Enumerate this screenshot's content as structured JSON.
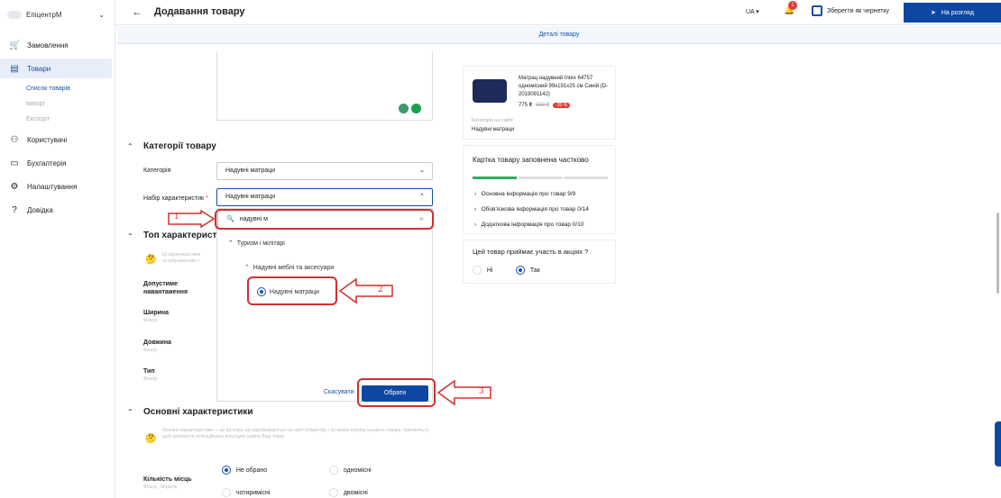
{
  "sidebar": {
    "brand": "ЕпіцентрМ",
    "items": [
      {
        "label": "Замовлення",
        "icon": "cart-icon"
      },
      {
        "label": "Товари",
        "icon": "box-icon"
      },
      {
        "label": "Користувачі",
        "icon": "users-icon"
      },
      {
        "label": "Бухгалтерія",
        "icon": "wallet-icon"
      },
      {
        "label": "Налаштування",
        "icon": "gear-icon"
      },
      {
        "label": "Довідка",
        "icon": "help-icon"
      }
    ],
    "subitems": [
      "Список товарів",
      "Імпорт",
      "Експорт"
    ]
  },
  "header": {
    "title": "Додавання товару",
    "lang": "UA",
    "notif_count": "1",
    "save_draft": "Зберегти як чернетку",
    "review": "На розгляд"
  },
  "tabs": {
    "details": "Деталі товару"
  },
  "sections": {
    "categories_title": "Категорії товару",
    "top_title": "Топ характеристи",
    "basic_title": "Основні характеристики"
  },
  "fields": {
    "category_label": "Категорія",
    "category_value": "Надувні матраци",
    "set_label": "Набір характеристик",
    "set_required": "*",
    "set_value": "Надувні матраци"
  },
  "dropdown": {
    "search_value": "надувні м",
    "level1": "Туризм і мілітарі",
    "level2": "Надувні меблі та аксесуари",
    "option": "Надувні матраци",
    "cancel": "Скасувати",
    "select": "Обрати"
  },
  "annotations": [
    "1",
    "2",
    "3"
  ],
  "top_chars": {
    "info": "Ці характеристики\nта зображенням т",
    "rows": [
      {
        "label": "Допустиме навантаження",
        "hint": ""
      },
      {
        "label": "Ширина",
        "hint": "Фільтр"
      },
      {
        "label": "Довжина",
        "hint": "Фільтр"
      },
      {
        "label": "Тип",
        "hint": "Фільтр"
      }
    ]
  },
  "basic_chars": {
    "info": "Основні характеристики — це фільтри, що відображаються на сайті Епіцентру, і за якими покупці шукають товари. Заповніть їх, щоб допомогти потенційному покупцеві знайти Ваш товар",
    "places_label": "Кількість місць",
    "places_hint": "Фільтр , Модель",
    "options": [
      "Не обрано",
      "одномісні",
      "чотиримісні",
      "двомісні"
    ]
  },
  "product_card": {
    "name": "Матрац надувний Intex 64757 одномісний 99x191x25 см Синій (D-2019091142)",
    "price": "775 ₴",
    "old_price": "969 ₴",
    "discount": "-20 %",
    "category_label": "Категорія на сайті",
    "category_value": "Надувні матраци"
  },
  "completeness": {
    "title": "Картка товару заповнена частково",
    "progress_fraction": 0.33,
    "items": [
      "Основна інформація про товар 9/9",
      "Обов'язкова інформація про товар 0/14",
      "Додаткова інформація про товар 0/10"
    ]
  },
  "promo": {
    "question": "Цей товар приймає участь в акціях ?",
    "no": "Ні",
    "yes": "Так"
  },
  "colors": {
    "primary": "#0d47a1",
    "annotation": "#d32f2f",
    "accent_green": "#2eae61"
  }
}
